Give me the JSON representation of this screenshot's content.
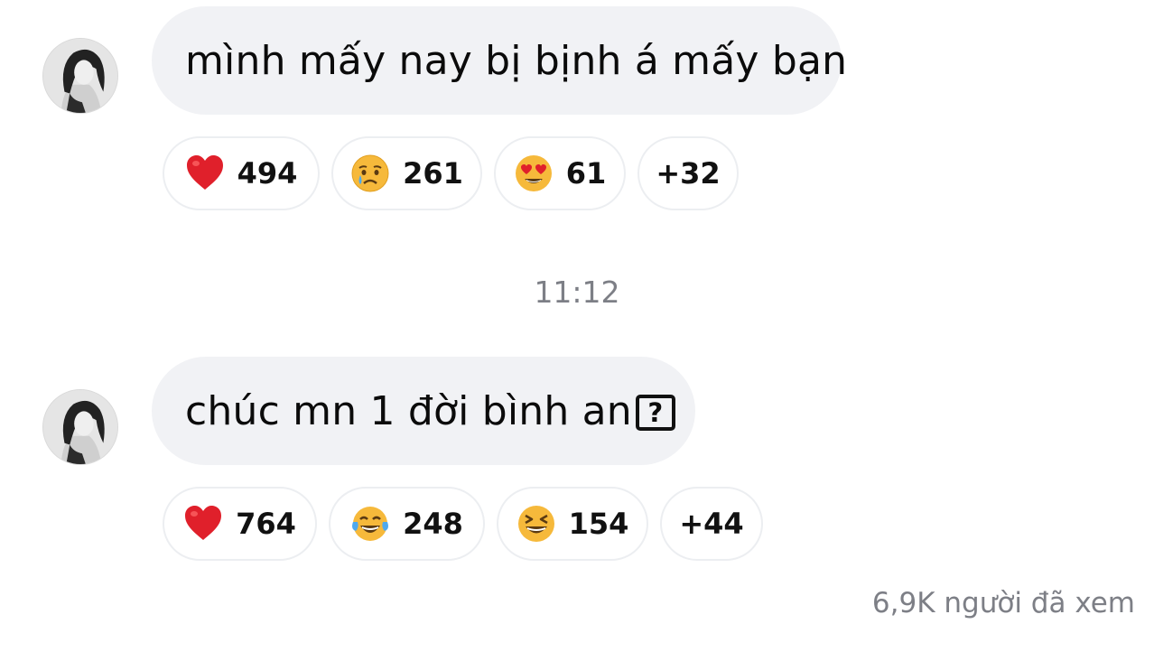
{
  "messages": [
    {
      "text": "mình mấy nay bị bịnh á mấy bạn",
      "reactions": [
        {
          "emoji": "red-heart",
          "count": "494"
        },
        {
          "emoji": "crying-face",
          "count": "261"
        },
        {
          "emoji": "heart-eyes-face",
          "count": "61"
        },
        {
          "emoji": null,
          "count": "+32"
        }
      ]
    },
    {
      "text": "chúc mn 1 đời bình an",
      "unsupported_glyph": "?",
      "reactions": [
        {
          "emoji": "red-heart",
          "count": "764"
        },
        {
          "emoji": "tears-of-joy-face",
          "count": "248"
        },
        {
          "emoji": "laughing-squint-face",
          "count": "154"
        },
        {
          "emoji": null,
          "count": "+44"
        }
      ]
    }
  ],
  "timestamp": "11:12",
  "seen_text": "6,9K người đã xem",
  "colors": {
    "bubble_bg": "#f1f2f5",
    "chip_border": "#eceef1",
    "meta_text": "#7d7f86",
    "heart": "#e0202b",
    "emoji_yellow": "#f6b93b"
  }
}
